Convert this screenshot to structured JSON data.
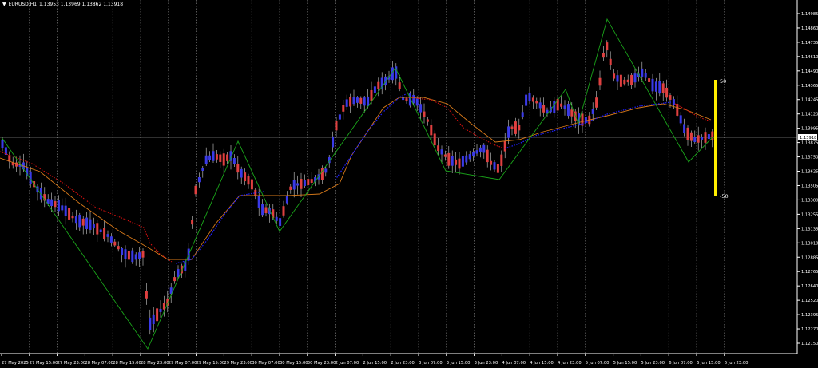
{
  "header": {
    "symbol": "EURUSD,H1",
    "quote": "1.13953 1.13969 1.13862 1.13918"
  },
  "colors": {
    "background": "#000000",
    "bull_candle": "#e04040",
    "bear_candle": "#3a3ae8",
    "zigzag": "#1aa51a",
    "ma_orange": "#d97a1a",
    "ma_red": "#e01010",
    "ma_blue": "#2020ff",
    "bid_line": "#c0c0c0",
    "indicator_bar": "#ffee00",
    "axis_text": "#ffffff"
  },
  "chart_data": {
    "type": "candlestick",
    "price_axis": {
      "min": 1.1215,
      "max": 1.14985,
      "ticks": [
        "1.14985",
        "1.14860",
        "1.14735",
        "1.14610",
        "1.14490",
        "1.14365",
        "1.14245",
        "1.14120",
        "1.13995",
        "1.13875",
        "1.13750",
        "1.13625",
        "1.13505",
        "1.13380",
        "1.13255",
        "1.13135",
        "1.13010",
        "1.12885",
        "1.12765",
        "1.12640",
        "1.12520",
        "1.12395",
        "1.12270",
        "1.12150"
      ]
    },
    "time_axis": [
      "27 May 2025",
      "27 May 15:00",
      "27 May 23:00",
      "28 May 07:00",
      "28 May 15:00",
      "28 May 23:00",
      "29 May 07:00",
      "29 May 15:00",
      "29 May 23:00",
      "30 May 07:00",
      "30 May 15:00",
      "30 May 23:00",
      "2 Jun 07:00",
      "2 Jun 15:00",
      "2 Jun 23:00",
      "3 Jun 07:00",
      "3 Jun 15:00",
      "3 Jun 23:00",
      "4 Jun 07:00",
      "4 Jun 15:00",
      "4 Jun 23:00",
      "5 Jun 07:00",
      "5 Jun 15:00",
      "5 Jun 23:00",
      "6 Jun 07:00",
      "6 Jun 15:00",
      "6 Jun 23:00"
    ],
    "current_price": "1.13918",
    "indicator_labels": {
      "upper": "50",
      "lower": "-50"
    }
  }
}
